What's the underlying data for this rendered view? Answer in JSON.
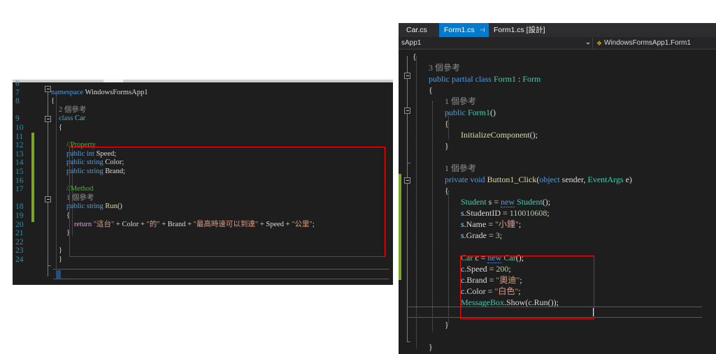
{
  "left_pane": {
    "name": "car-class-editor",
    "first_line_number": 6,
    "lines": [
      {
        "n": "6",
        "segments": []
      },
      {
        "n": "7",
        "segments": [
          {
            "c": "k",
            "t": "namespace "
          },
          {
            "c": "p",
            "t": "WindowsFormsApp1"
          }
        ]
      },
      {
        "n": "8",
        "segments": [
          {
            "c": "p",
            "t": "{"
          }
        ]
      },
      {
        "n": "",
        "segments": [
          {
            "c": "ref",
            "t": "2 個參考"
          }
        ]
      },
      {
        "n": "9",
        "segments": [
          {
            "c": "k",
            "t": "class "
          },
          {
            "c": "t",
            "t": "Car"
          }
        ]
      },
      {
        "n": "10",
        "segments": [
          {
            "c": "p",
            "t": "{"
          }
        ]
      },
      {
        "n": "11",
        "segments": []
      },
      {
        "n": "12",
        "segments": [
          {
            "c": "c",
            "t": "//Property"
          }
        ]
      },
      {
        "n": "13",
        "segments": [
          {
            "c": "k",
            "t": "public int "
          },
          {
            "c": "p",
            "t": "Speed;"
          }
        ]
      },
      {
        "n": "14",
        "segments": [
          {
            "c": "k",
            "t": "public string "
          },
          {
            "c": "p",
            "t": "Color;"
          }
        ]
      },
      {
        "n": "15",
        "segments": [
          {
            "c": "k",
            "t": "public string "
          },
          {
            "c": "p",
            "t": "Brand;"
          }
        ]
      },
      {
        "n": "16",
        "segments": []
      },
      {
        "n": "17",
        "segments": [
          {
            "c": "c",
            "t": "//Method"
          }
        ]
      },
      {
        "n": "",
        "segments": [
          {
            "c": "ref",
            "t": "1 個參考"
          }
        ]
      },
      {
        "n": "18",
        "segments": [
          {
            "c": "k",
            "t": "public string "
          },
          {
            "c": "id",
            "t": "Run"
          },
          {
            "c": "p",
            "t": "()"
          }
        ]
      },
      {
        "n": "19",
        "segments": [
          {
            "c": "p",
            "t": "{"
          }
        ]
      },
      {
        "n": "20",
        "segments": [
          {
            "c": "ctl",
            "t": "return "
          },
          {
            "c": "s",
            "t": "\"這台\""
          },
          {
            "c": "p",
            "t": " + Color + "
          },
          {
            "c": "s",
            "t": "\"的\""
          },
          {
            "c": "p",
            "t": " + Brand + "
          },
          {
            "c": "s",
            "t": "\"最高時速可以到達\""
          },
          {
            "c": "p",
            "t": " + Speed + "
          },
          {
            "c": "s",
            "t": "\"公里\""
          },
          {
            "c": "p",
            "t": ";"
          }
        ]
      },
      {
        "n": "21",
        "segments": [
          {
            "c": "p",
            "t": "}"
          }
        ]
      },
      {
        "n": "22",
        "segments": []
      },
      {
        "n": "23",
        "segments": [
          {
            "c": "p",
            "t": "}"
          }
        ]
      },
      {
        "n": "24",
        "segments": [
          {
            "c": "p",
            "t": "}"
          }
        ]
      }
    ],
    "annotation_box_label": "red-highlight-property-and-method"
  },
  "right_pane": {
    "name": "form1-cs-editor",
    "tabs": [
      {
        "label": "Car.cs",
        "active": false,
        "closable": false
      },
      {
        "label": "Form1.cs",
        "active": true,
        "closable": true,
        "pin_icon": "pin-icon",
        "close_icon": "close-icon"
      },
      {
        "label": "Form1.cs [設計]",
        "active": false,
        "closable": false
      }
    ],
    "navbar": {
      "left_value": "sApp1",
      "dropdown_icon": "chevron-down-icon",
      "member_icon": "class-icon",
      "right_value": "WindowsFormsApp1.Form1"
    },
    "lines": [
      {
        "segments": [
          {
            "c": "p",
            "t": "{"
          }
        ],
        "indent": 0
      },
      {
        "segments": [
          {
            "c": "ref",
            "t": "3 個參考"
          }
        ],
        "indent": 1
      },
      {
        "segments": [
          {
            "c": "k",
            "t": "public partial class "
          },
          {
            "c": "t",
            "t": "Form1"
          },
          {
            "c": "p",
            "t": " : "
          },
          {
            "c": "t",
            "t": "Form"
          }
        ],
        "indent": 1
      },
      {
        "segments": [
          {
            "c": "p",
            "t": "{"
          }
        ],
        "indent": 1
      },
      {
        "segments": [
          {
            "c": "ref",
            "t": "1 個參考"
          }
        ],
        "indent": 2
      },
      {
        "segments": [
          {
            "c": "k",
            "t": "public "
          },
          {
            "c": "t",
            "t": "Form1"
          },
          {
            "c": "p",
            "t": "()"
          }
        ],
        "indent": 2
      },
      {
        "segments": [
          {
            "c": "p",
            "t": "{"
          }
        ],
        "indent": 2
      },
      {
        "segments": [
          {
            "c": "id",
            "t": "InitializeComponent"
          },
          {
            "c": "p",
            "t": "();"
          }
        ],
        "indent": 3
      },
      {
        "segments": [
          {
            "c": "p",
            "t": "}"
          }
        ],
        "indent": 2
      },
      {
        "segments": [],
        "indent": 0
      },
      {
        "segments": [
          {
            "c": "ref",
            "t": "1 個參考"
          }
        ],
        "indent": 2
      },
      {
        "segments": [
          {
            "c": "k",
            "t": "private void "
          },
          {
            "c": "id",
            "t": "Button1_Click"
          },
          {
            "c": "p",
            "t": "("
          },
          {
            "c": "k",
            "t": "object"
          },
          {
            "c": "p",
            "t": " sender, "
          },
          {
            "c": "t",
            "t": "EventArgs"
          },
          {
            "c": "p",
            "t": " e)"
          }
        ],
        "indent": 2
      },
      {
        "segments": [
          {
            "c": "p",
            "t": "{"
          }
        ],
        "indent": 2
      },
      {
        "segments": [
          {
            "c": "t",
            "t": "Student"
          },
          {
            "c": "p",
            "t": " s = "
          },
          {
            "c": "newkw",
            "t": "new"
          },
          {
            "c": "p",
            "t": " "
          },
          {
            "c": "t",
            "t": "Student"
          },
          {
            "c": "p",
            "t": "();"
          }
        ],
        "indent": 3
      },
      {
        "segments": [
          {
            "c": "loc",
            "t": "s"
          },
          {
            "c": "p",
            "t": ".StudentID = "
          },
          {
            "c": "n",
            "t": "110010608"
          },
          {
            "c": "p",
            "t": ";"
          }
        ],
        "indent": 3
      },
      {
        "segments": [
          {
            "c": "loc",
            "t": "s"
          },
          {
            "c": "p",
            "t": ".Name = "
          },
          {
            "c": "s",
            "t": "\"小鍾\""
          },
          {
            "c": "p",
            "t": ";"
          }
        ],
        "indent": 3
      },
      {
        "segments": [
          {
            "c": "loc",
            "t": "s"
          },
          {
            "c": "p",
            "t": ".Grade = "
          },
          {
            "c": "n",
            "t": "3"
          },
          {
            "c": "p",
            "t": ";"
          }
        ],
        "indent": 3
      },
      {
        "segments": [],
        "indent": 0
      },
      {
        "segments": [
          {
            "c": "t",
            "t": "Car"
          },
          {
            "c": "p",
            "t": " c = "
          },
          {
            "c": "newkw",
            "t": "new"
          },
          {
            "c": "p",
            "t": " "
          },
          {
            "c": "t",
            "t": "Car"
          },
          {
            "c": "p",
            "t": "();"
          }
        ],
        "indent": 3
      },
      {
        "segments": [
          {
            "c": "loc",
            "t": "c"
          },
          {
            "c": "p",
            "t": ".Speed = "
          },
          {
            "c": "n",
            "t": "200"
          },
          {
            "c": "p",
            "t": ";"
          }
        ],
        "indent": 3
      },
      {
        "segments": [
          {
            "c": "loc",
            "t": "c"
          },
          {
            "c": "p",
            "t": ".Brand = "
          },
          {
            "c": "s",
            "t": "\"奧迪\""
          },
          {
            "c": "p",
            "t": ";"
          }
        ],
        "indent": 3
      },
      {
        "segments": [
          {
            "c": "loc",
            "t": "c"
          },
          {
            "c": "p",
            "t": ".Color = "
          },
          {
            "c": "s",
            "t": "\"白色\""
          },
          {
            "c": "p",
            "t": ";"
          }
        ],
        "indent": 3
      },
      {
        "segments": [
          {
            "c": "t",
            "t": "MessageBox"
          },
          {
            "c": "p",
            "t": ".Show("
          },
          {
            "c": "loc",
            "t": "c"
          },
          {
            "c": "p",
            "t": ".Run());"
          }
        ],
        "indent": 3
      },
      {
        "segments": [],
        "indent": 0
      },
      {
        "segments": [
          {
            "c": "p",
            "t": "}"
          }
        ],
        "indent": 2
      },
      {
        "segments": [],
        "indent": 0
      },
      {
        "segments": [
          {
            "c": "p",
            "t": "}"
          }
        ],
        "indent": 1
      }
    ],
    "annotation_box_label": "red-highlight-car-usage"
  },
  "colors": {
    "annotation": "#ff0000",
    "editor_background": "#1e1e1e",
    "active_tab": "#007acc",
    "tabstrip": "#2d2d30",
    "changebar": "#7ba428"
  }
}
